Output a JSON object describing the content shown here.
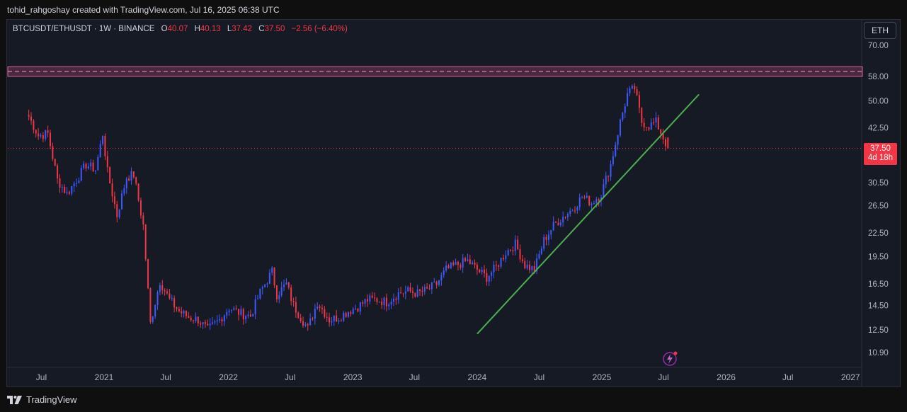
{
  "header": {
    "attribution": "tohid_rahgoshay created with TradingView.com, Jul 16, 2025 06:38 UTC"
  },
  "legend": {
    "symbol": "BTCUSDT/ETHUSDT · 1W · BINANCE",
    "open_label": "O",
    "open": "40.07",
    "high_label": "H",
    "high": "40.13",
    "low_label": "L",
    "low": "37.42",
    "close_label": "C",
    "close": "37.50",
    "change": "−2.56 (−6.40%)"
  },
  "currency_button": "ETH",
  "price_tag": {
    "price": "37.50",
    "countdown": "4d 18h"
  },
  "footer": {
    "brand": "TradingView"
  },
  "colors": {
    "up": "#3d5afe",
    "down": "#f23645",
    "trendline": "#4caf50",
    "zone_fill": "#5c2f4a",
    "background": "#161a25"
  },
  "chart_data": {
    "type": "candlestick",
    "symbol": "BTCUSDT/ETHUSDT",
    "interval": "1W",
    "scale": "log",
    "y_ticks": [
      70.0,
      58.0,
      50.0,
      42.5,
      30.5,
      26.5,
      22.5,
      19.5,
      16.5,
      14.5,
      12.5,
      10.9
    ],
    "y_tick_labels": [
      "70.00",
      "58.00",
      "50.00",
      "42.50",
      "30.50",
      "26.50",
      "22.50",
      "19.50",
      "16.50",
      "14.50",
      "12.50",
      "10.90"
    ],
    "x_ticks": [
      "2020-07-01",
      "2021-01-01",
      "2021-07-01",
      "2022-01-01",
      "2022-07-01",
      "2023-01-01",
      "2023-07-01",
      "2024-01-01",
      "2024-07-01",
      "2025-01-01",
      "2025-07-01",
      "2026-01-01",
      "2026-07-01",
      "2027-01-01"
    ],
    "x_tick_labels": [
      "Jul",
      "2021",
      "Jul",
      "2022",
      "Jul",
      "2023",
      "Jul",
      "2024",
      "Jul",
      "2025",
      "Jul",
      "2026",
      "Jul",
      "2027"
    ],
    "close_series": [
      [
        "2020-05-25",
        45.5
      ],
      [
        "2020-06-22",
        40.5
      ],
      [
        "2020-07-20",
        41.0
      ],
      [
        "2020-08-17",
        31.0
      ],
      [
        "2020-09-14",
        28.5
      ],
      [
        "2020-10-12",
        31.0
      ],
      [
        "2020-11-09",
        34.0
      ],
      [
        "2020-12-07",
        33.0
      ],
      [
        "2020-12-28",
        41.0
      ],
      [
        "2021-01-11",
        32.5
      ],
      [
        "2021-02-08",
        25.0
      ],
      [
        "2021-03-08",
        31.5
      ],
      [
        "2021-03-29",
        32.0
      ],
      [
        "2021-04-26",
        23.5
      ],
      [
        "2021-05-17",
        13.0
      ],
      [
        "2021-06-14",
        16.8
      ],
      [
        "2021-07-12",
        15.0
      ],
      [
        "2021-08-09",
        14.0
      ],
      [
        "2021-09-06",
        13.5
      ],
      [
        "2021-10-04",
        13.3
      ],
      [
        "2021-11-01",
        12.5
      ],
      [
        "2021-12-06",
        13.3
      ],
      [
        "2022-01-03",
        14.3
      ],
      [
        "2022-02-07",
        13.8
      ],
      [
        "2022-03-07",
        13.6
      ],
      [
        "2022-04-04",
        15.7
      ],
      [
        "2022-05-09",
        17.8
      ],
      [
        "2022-05-23",
        15.5
      ],
      [
        "2022-06-20",
        16.5
      ],
      [
        "2022-07-11",
        14.5
      ],
      [
        "2022-08-22",
        12.6
      ],
      [
        "2022-09-19",
        14.8
      ],
      [
        "2022-10-24",
        13.3
      ],
      [
        "2022-11-21",
        13.5
      ],
      [
        "2022-12-19",
        14.0
      ],
      [
        "2023-01-16",
        14.4
      ],
      [
        "2023-02-13",
        15.0
      ],
      [
        "2023-03-13",
        15.0
      ],
      [
        "2023-04-10",
        14.8
      ],
      [
        "2023-05-15",
        15.6
      ],
      [
        "2023-06-12",
        15.8
      ],
      [
        "2023-07-10",
        15.6
      ],
      [
        "2023-08-07",
        15.9
      ],
      [
        "2023-09-04",
        16.5
      ],
      [
        "2023-10-02",
        18.0
      ],
      [
        "2023-10-30",
        18.5
      ],
      [
        "2023-12-04",
        19.0
      ],
      [
        "2024-01-01",
        18.0
      ],
      [
        "2024-01-29",
        17.2
      ],
      [
        "2024-02-26",
        18.3
      ],
      [
        "2024-03-25",
        20.0
      ],
      [
        "2024-04-22",
        21.0
      ],
      [
        "2024-05-20",
        18.5
      ],
      [
        "2024-06-17",
        18.0
      ],
      [
        "2024-07-15",
        21.5
      ],
      [
        "2024-08-12",
        23.5
      ],
      [
        "2024-09-09",
        24.8
      ],
      [
        "2024-10-07",
        26.0
      ],
      [
        "2024-11-04",
        28.0
      ],
      [
        "2024-12-02",
        27.0
      ],
      [
        "2024-12-30",
        28.5
      ],
      [
        "2025-01-27",
        34.0
      ],
      [
        "2025-02-24",
        44.0
      ],
      [
        "2025-03-17",
        52.0
      ],
      [
        "2025-04-07",
        54.0
      ],
      [
        "2025-04-28",
        44.0
      ],
      [
        "2025-05-19",
        43.0
      ],
      [
        "2025-06-09",
        44.0
      ],
      [
        "2025-06-30",
        40.07
      ],
      [
        "2025-07-14",
        37.5
      ]
    ],
    "last": {
      "open": 40.07,
      "high": 40.13,
      "low": 37.42,
      "close": 37.5,
      "change": -2.56,
      "change_pct": -6.4
    },
    "resistance_zone": {
      "low": 58.0,
      "high": 61.5
    },
    "trendline": {
      "from": [
        "2024-01-01",
        12.2
      ],
      "to": [
        "2025-10-13",
        52.0
      ]
    },
    "current_price_line": 37.5
  }
}
